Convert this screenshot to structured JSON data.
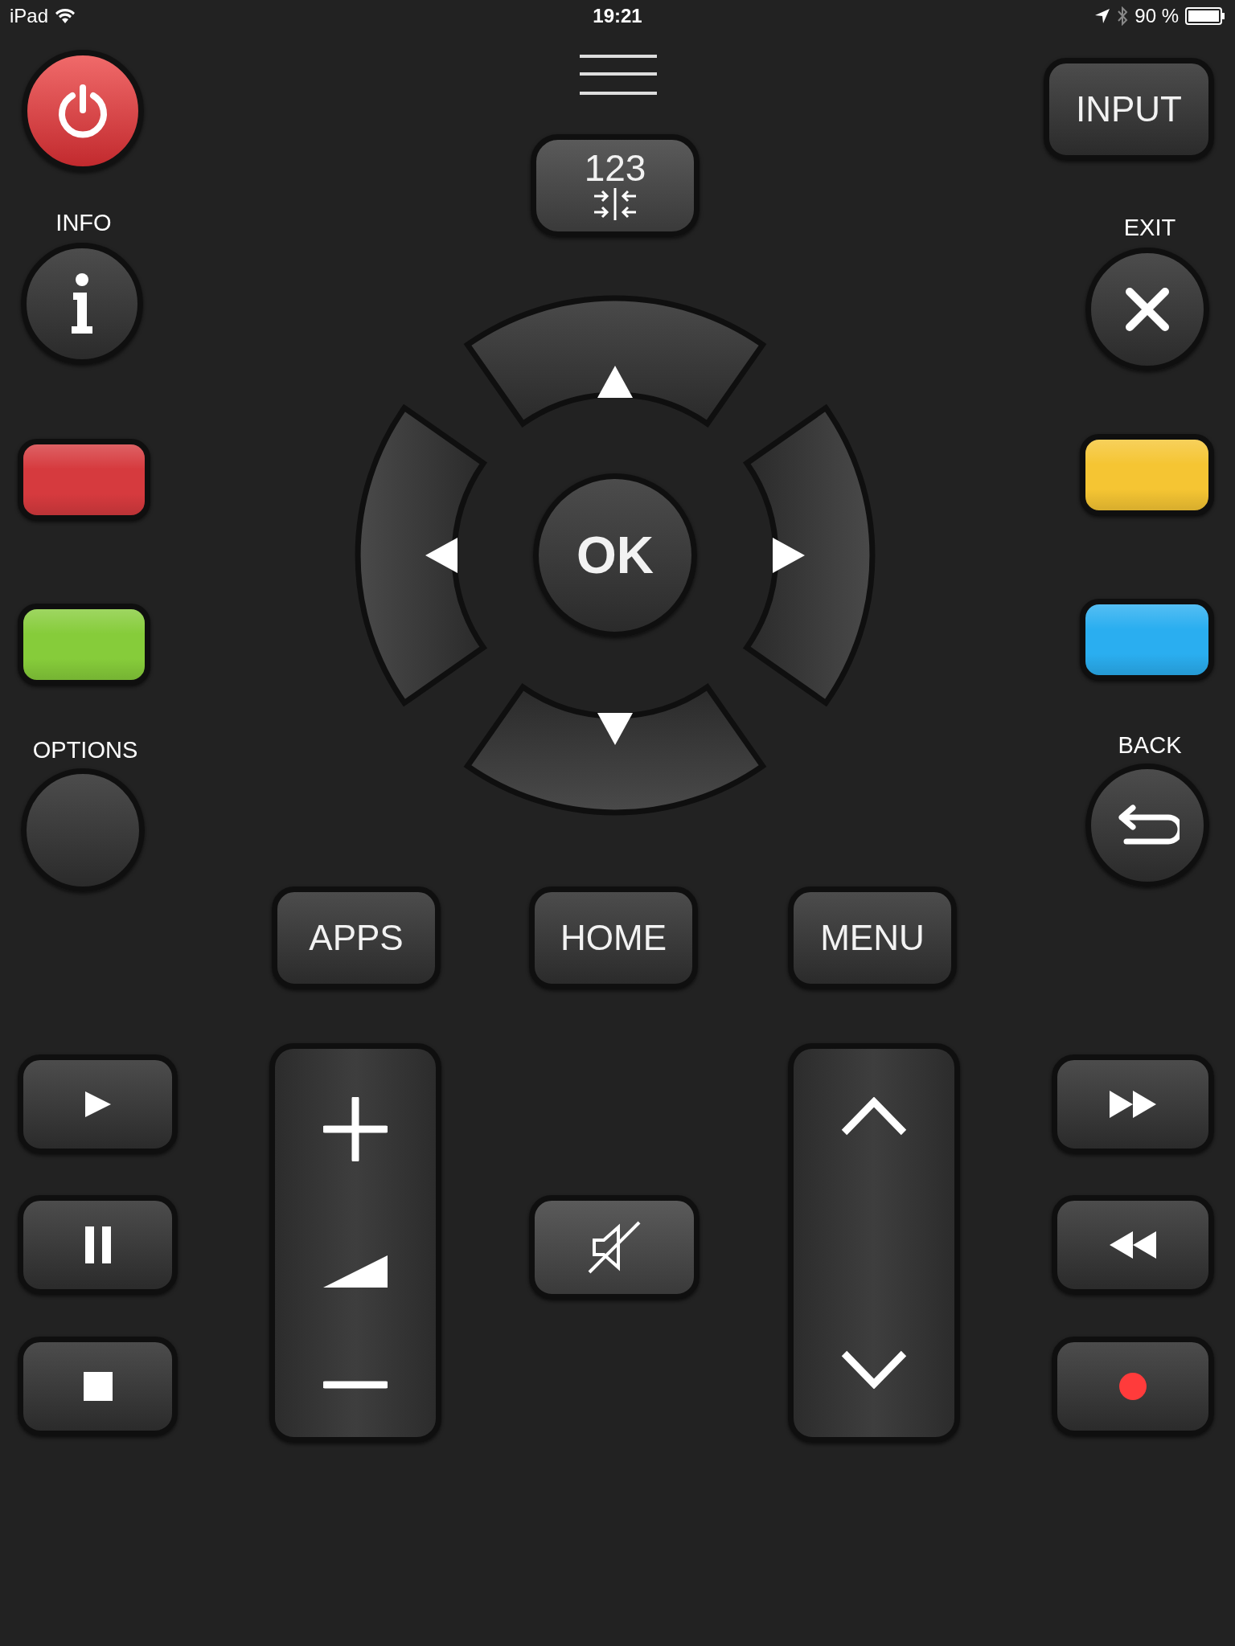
{
  "status_bar": {
    "device": "iPad",
    "time": "19:21",
    "battery": "90 %"
  },
  "top": {
    "input": "INPUT",
    "numpad": "123"
  },
  "labels": {
    "info": "INFO",
    "exit": "EXIT",
    "options": "OPTIONS",
    "back": "BACK"
  },
  "color_keys": [
    {
      "color": "#d63a3e"
    },
    {
      "color": "#f5c533"
    },
    {
      "color": "#86cc3a"
    },
    {
      "color": "#2aaef0"
    }
  ],
  "dpad": {
    "ok": "OK"
  },
  "nav": [
    {
      "label": "APPS"
    },
    {
      "label": "HOME"
    },
    {
      "label": "MENU"
    }
  ]
}
